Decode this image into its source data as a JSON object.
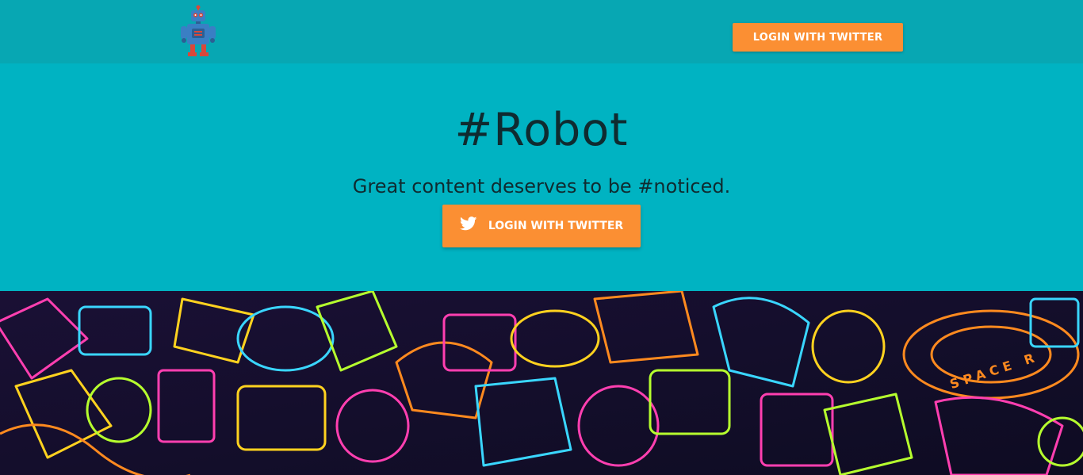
{
  "header": {
    "logo_icon": "robot-icon",
    "login_label": "LOGIN WITH TWITTER"
  },
  "hero": {
    "title": "#Robot",
    "tagline": "Great content deserves to be #noticed.",
    "login_label": "LOGIN WITH TWITTER",
    "login_icon": "twitter-icon"
  },
  "banner": {
    "text": "SPACE R"
  },
  "colors": {
    "navbar": "#07a7b3",
    "hero": "#00b3c2",
    "button": "#fb8f33",
    "text_dark": "#0f2b30",
    "banner_bg": "#140f2a"
  }
}
